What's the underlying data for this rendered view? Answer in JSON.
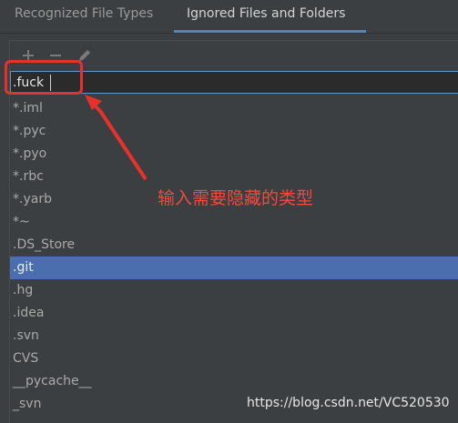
{
  "tabs": [
    {
      "label": "Recognized File Types",
      "active": false
    },
    {
      "label": "Ignored Files and Folders",
      "active": true
    }
  ],
  "toolbar": {
    "add_icon": "plus-icon",
    "remove_icon": "minus-icon",
    "edit_icon": "pencil-icon"
  },
  "editor": {
    "value": ".fuck"
  },
  "patterns": [
    "*.iml",
    "*.pyc",
    "*.pyo",
    "*.rbc",
    "*.yarb",
    "*~",
    ".DS_Store",
    ".git",
    ".hg",
    ".idea",
    ".svn",
    "CVS",
    "__pycache__",
    "_svn"
  ],
  "selected_pattern": ".git",
  "annotation": {
    "text": "输入需要隐藏的类型",
    "color": "#e8312b"
  },
  "watermark": "https://blog.csdn.net/VC520530",
  "colors": {
    "selection": "#4b6eaf",
    "tab_underline": "#4a88c7"
  }
}
